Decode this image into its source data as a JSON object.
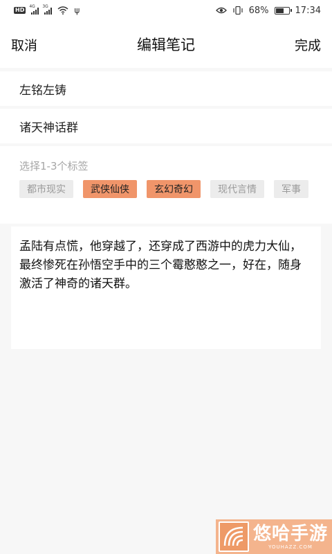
{
  "status_bar": {
    "hd_badge": "HD",
    "signal_1_label": "4G",
    "signal_2_label": "3G",
    "battery_percent": "68%",
    "battery_level": 0.68,
    "time": "17:34",
    "icons": [
      "hd-icon",
      "signal-icon",
      "signal-icon",
      "wifi-icon",
      "usb-icon",
      "eye-icon",
      "vibrate-icon",
      "battery-icon"
    ]
  },
  "header": {
    "cancel_label": "取消",
    "title": "编辑笔记",
    "done_label": "完成"
  },
  "form": {
    "field_1_value": "左铭左铸",
    "field_2_value": "诸天神话群"
  },
  "tags": {
    "hint": "选择1-3个标签",
    "items": [
      {
        "label": "都市现实",
        "selected": false
      },
      {
        "label": "武侠仙侠",
        "selected": true
      },
      {
        "label": "玄幻奇幻",
        "selected": true
      },
      {
        "label": "现代言情",
        "selected": false
      },
      {
        "label": "军事",
        "selected": false
      }
    ]
  },
  "note": {
    "content": "孟陆有点慌，他穿越了，还穿成了西游中的虎力大仙，最终惨死在孙悟空手中的三个霉憨憨之一，好在，随身激活了神奇的诸天群。"
  },
  "watermark": {
    "name": "悠哈手游",
    "url": "YOUHAZZ.COM"
  },
  "colors": {
    "tag_selected": "#f0956a",
    "tag_default": "#ececec",
    "background": "#f7f7f7",
    "watermark": "#f4b48d"
  }
}
